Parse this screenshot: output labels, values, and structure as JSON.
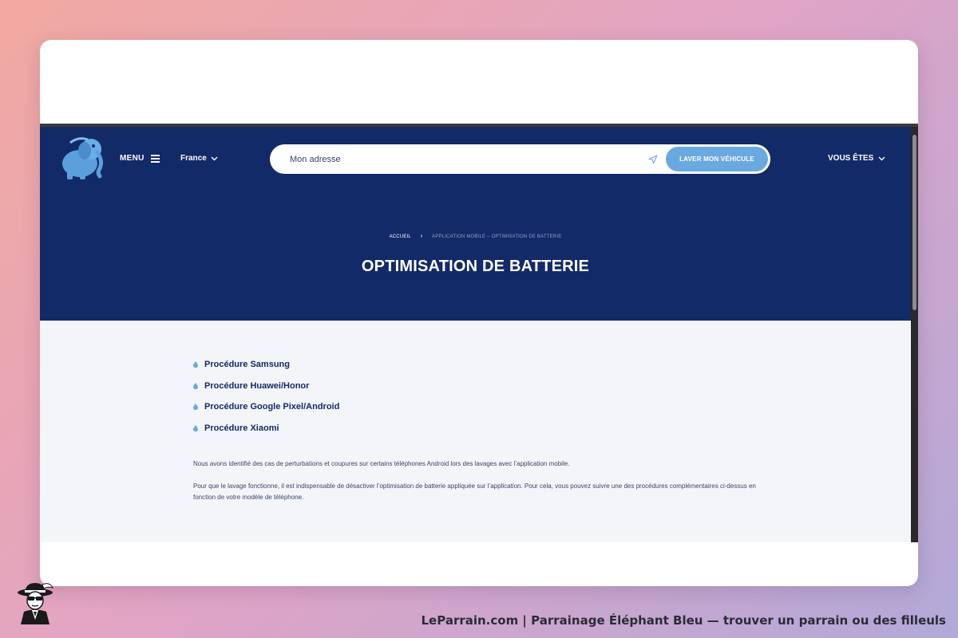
{
  "header": {
    "menu_label": "MENU",
    "country_label": "France",
    "search": {
      "placeholder": "Mon adresse",
      "value": ""
    },
    "cta_label": "LAVER MON VÉHICULE",
    "vous_etes_label": "VOUS ÊTES"
  },
  "breadcrumb": {
    "home": "ACCUEIL",
    "current": "APPLICATION MOBILE – OPTIMISATION DE BATTERIE"
  },
  "page_title": "OPTIMISATION DE BATTERIE",
  "procedures": [
    {
      "label": "Procédure Samsung"
    },
    {
      "label": "Procédure Huawei/Honor"
    },
    {
      "label": "Procédure Google Pixel/Android"
    },
    {
      "label": "Procédure Xiaomi"
    }
  ],
  "paragraphs": {
    "p1": "Nous avons identifié des cas de perturbations et coupures sur certains téléphones Android lors des lavages avec l’application mobile.",
    "p2": "Pour que le lavage fonctionne, il est indispensable de désactiver l’optimisation de batterie appliquée sur l’application. Pour cela, vous pouvez suivre une des procédures complémentaires ci-dessus en fonction de votre modèle de téléphone."
  },
  "footer": {
    "caption": "LeParrain.com | Parrainage Éléphant Bleu — trouver un parrain ou des filleuls"
  },
  "colors": {
    "hero_bg": "#132a69",
    "accent": "#6aa9e0",
    "content_bg": "#f4f5f9"
  },
  "icons": [
    "elephant-logo-icon",
    "hamburger-icon",
    "chevron-down-icon",
    "location-arrow-icon",
    "droplet-bullet-icon",
    "godfather-logo-icon"
  ]
}
